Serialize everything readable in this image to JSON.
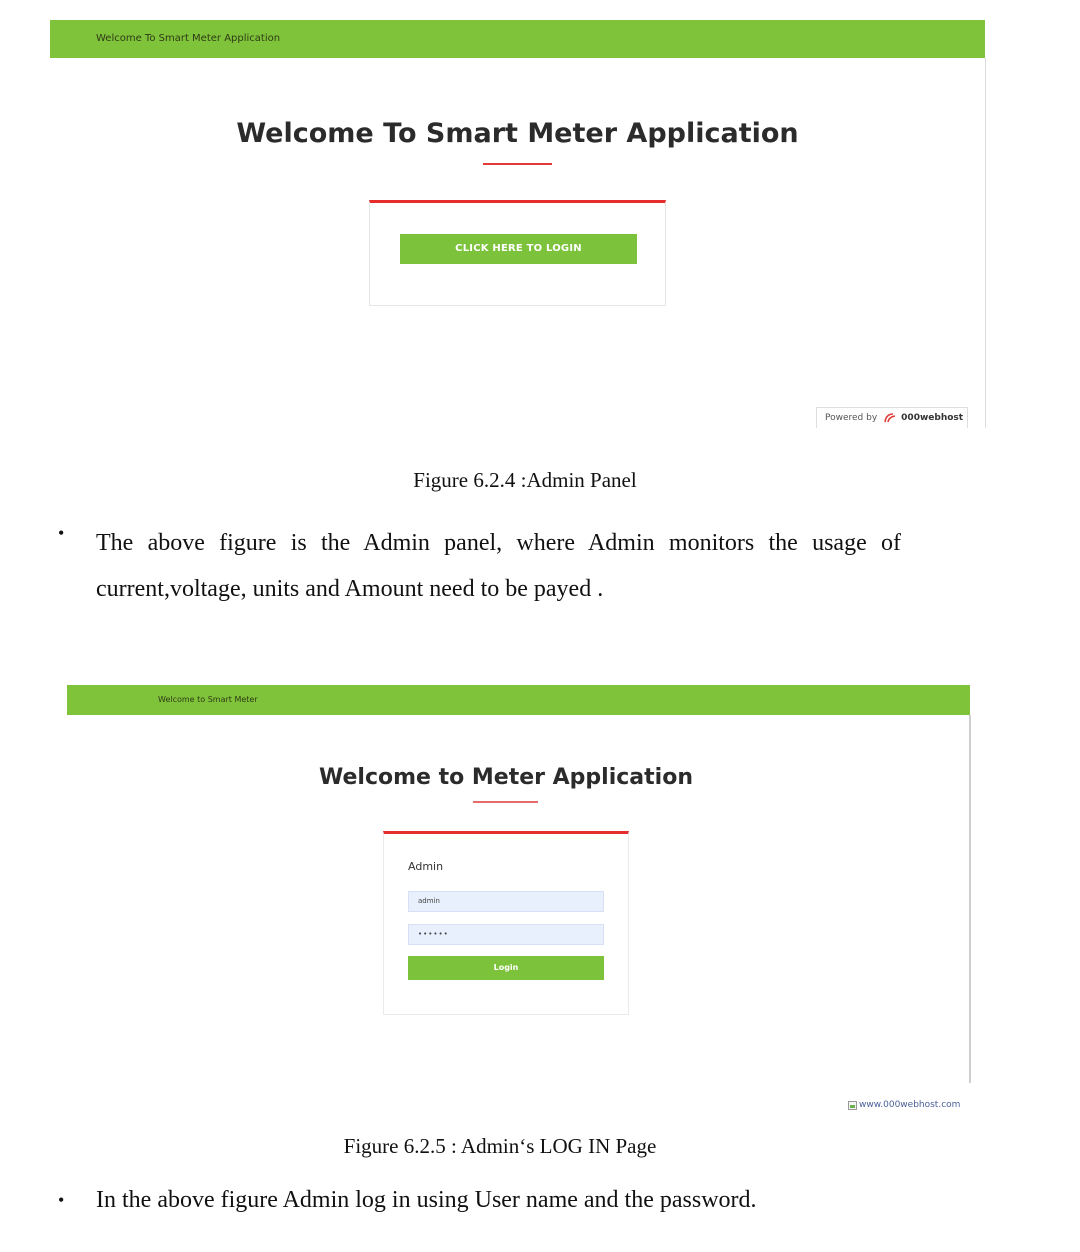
{
  "figure1": {
    "topbar_brand": "Welcome To Smart Meter Application",
    "title": "Welcome To Smart Meter Application",
    "login_link": "CLICK HERE TO LOGIN",
    "powered_by_label": "Powered by",
    "powered_by_host": "000webhost",
    "caption": "Figure 6.2.4 :Admin Panel"
  },
  "paragraph1": "The above figure is the Admin panel, where Admin monitors the usage of current,voltage, units and Amount need to be payed .",
  "figure2": {
    "topbar_brand": "Welcome to Smart Meter",
    "title": "Welcome to Meter Application",
    "form_label": "Admin",
    "username_value": "admin",
    "password_value": "••••••",
    "login_button": "Login",
    "broken_image_link": "www.000webhost.com",
    "caption": "Figure 6.2.5 : Admin‘s LOG IN Page"
  },
  "paragraph2": "In the above figure Admin log in using User name and the password.",
  "colors": {
    "green_bar": "#7fc33a",
    "red_accent": "#e52d2d",
    "input_bg": "#e8f0fd"
  }
}
